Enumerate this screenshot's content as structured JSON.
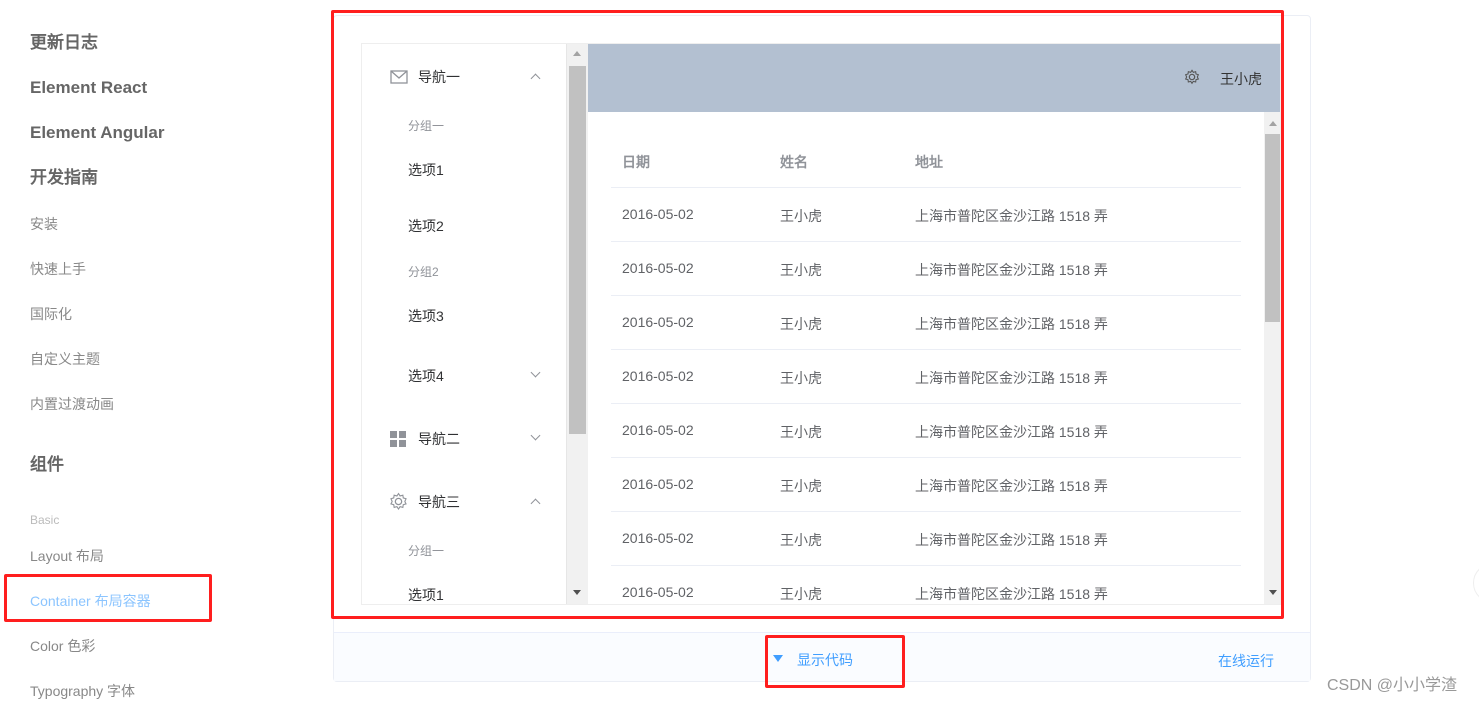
{
  "sidebar": {
    "items": [
      {
        "label": "更新日志",
        "type": "heading"
      },
      {
        "label": "Element React",
        "type": "heading"
      },
      {
        "label": "Element Angular",
        "type": "heading"
      },
      {
        "label": "开发指南",
        "type": "heading"
      },
      {
        "label": "安装"
      },
      {
        "label": "快速上手"
      },
      {
        "label": "国际化"
      },
      {
        "label": "自定义主题"
      },
      {
        "label": "内置过渡动画"
      },
      {
        "label": "组件",
        "type": "heading"
      },
      {
        "label": "Basic",
        "type": "group"
      },
      {
        "label": "Layout 布局"
      },
      {
        "label": "Container 布局容器",
        "active": true
      },
      {
        "label": "Color 色彩"
      },
      {
        "label": "Typography 字体"
      }
    ]
  },
  "demo": {
    "menu": {
      "nav1": "导航一",
      "group1": "分组一",
      "opt1": "选项1",
      "opt2": "选项2",
      "group2": "分组2",
      "opt3": "选项3",
      "opt4": "选项4",
      "nav2": "导航二",
      "nav3": "导航三",
      "nav3_group1": "分组一",
      "nav3_opt1": "选项1"
    },
    "header": {
      "user": "王小虎",
      "icon": "gear-icon",
      "bg": "#b3c0d1"
    },
    "table": {
      "columns": [
        "日期",
        "姓名",
        "地址"
      ],
      "rows": [
        [
          "2016-05-02",
          "王小虎",
          "上海市普陀区金沙江路 1518 弄"
        ],
        [
          "2016-05-02",
          "王小虎",
          "上海市普陀区金沙江路 1518 弄"
        ],
        [
          "2016-05-02",
          "王小虎",
          "上海市普陀区金沙江路 1518 弄"
        ],
        [
          "2016-05-02",
          "王小虎",
          "上海市普陀区金沙江路 1518 弄"
        ],
        [
          "2016-05-02",
          "王小虎",
          "上海市普陀区金沙江路 1518 弄"
        ],
        [
          "2016-05-02",
          "王小虎",
          "上海市普陀区金沙江路 1518 弄"
        ],
        [
          "2016-05-02",
          "王小虎",
          "上海市普陀区金沙江路 1518 弄"
        ],
        [
          "2016-05-02",
          "王小虎",
          "上海市普陀区金沙江路 1518 弄"
        ]
      ]
    }
  },
  "footer": {
    "show_code": "显示代码",
    "run_online": "在线运行"
  },
  "watermark": "CSDN @小小学渣",
  "colors": {
    "accent": "#409eff",
    "annotation": "#ff1e1e"
  }
}
